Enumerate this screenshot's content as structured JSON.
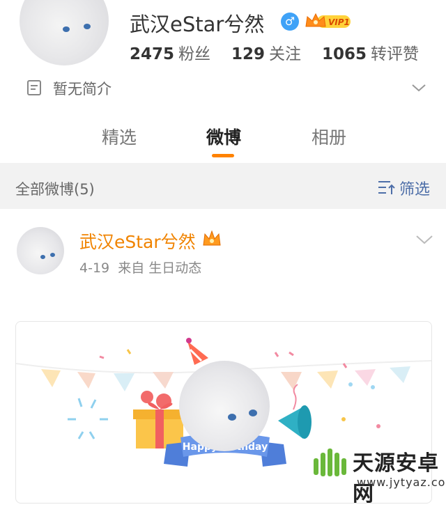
{
  "profile": {
    "name": "武汉eStar兮然",
    "gender_symbol": "♂",
    "vip_label": "VIP1",
    "stats": [
      {
        "value": "2475",
        "label": "粉丝"
      },
      {
        "value": "129",
        "label": "关注"
      },
      {
        "value": "1065",
        "label": "转评赞"
      }
    ],
    "bio": "暂无简介"
  },
  "tabs": [
    {
      "label": "精选"
    },
    {
      "label": "微博"
    },
    {
      "label": "相册"
    }
  ],
  "filter_bar": {
    "title": "全部微博(5)",
    "filter_label": "筛选"
  },
  "post": {
    "author": "武汉eStar兮然",
    "date": "4-19",
    "source": "来自 生日动态",
    "card": {
      "ribbon_text": "Happy Birthday"
    }
  },
  "watermark": {
    "title": "天源安卓网",
    "url": "www.jytyaz.com"
  },
  "colors": {
    "accent": "#ff8200",
    "author": "#f08300",
    "link": "#4d6ea8",
    "gender": "#3fa2f7"
  }
}
